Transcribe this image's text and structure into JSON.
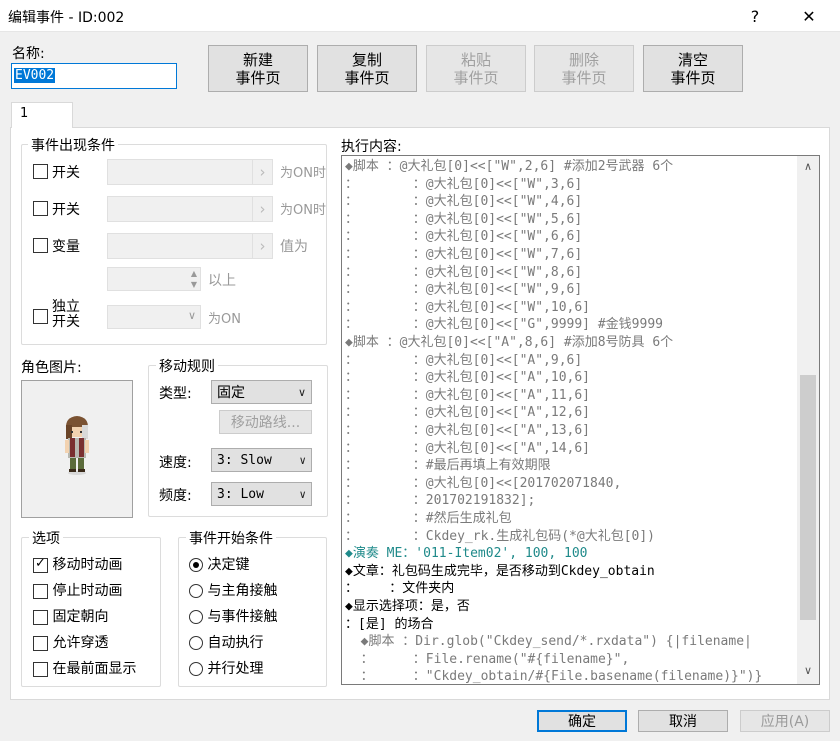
{
  "window": {
    "title": "编辑事件 - ID:002",
    "help": "?",
    "close": "✕"
  },
  "name": {
    "label": "名称:",
    "value": "EV002"
  },
  "top_buttons": [
    {
      "label": "新建\n事件页",
      "enabled": true
    },
    {
      "label": "复制\n事件页",
      "enabled": true
    },
    {
      "label": "粘贴\n事件页",
      "enabled": false
    },
    {
      "label": "删除\n事件页",
      "enabled": false
    },
    {
      "label": "清空\n事件页",
      "enabled": true
    }
  ],
  "tab": {
    "label": "1"
  },
  "conditions": {
    "title": "事件出现条件",
    "switch1": {
      "label": "开关",
      "suffix": "为ON时"
    },
    "switch2": {
      "label": "开关",
      "suffix": "为ON时"
    },
    "variable": {
      "label": "变量",
      "suffix": "值为",
      "suffix2": "以上"
    },
    "self_switch": {
      "label": "独立\n开关",
      "suffix": "为ON"
    }
  },
  "graphic": {
    "title": "角色图片:"
  },
  "movement": {
    "title": "移动规则",
    "type_label": "类型:",
    "type_value": "固定",
    "route_button": "移动路线...",
    "speed_label": "速度:",
    "speed_value": "3: Slow",
    "freq_label": "频度:",
    "freq_value": "3: Low"
  },
  "options": {
    "title": "选项",
    "items": [
      {
        "label": "移动时动画",
        "checked": true
      },
      {
        "label": "停止时动画",
        "checked": false
      },
      {
        "label": "固定朝向",
        "checked": false
      },
      {
        "label": "允许穿透",
        "checked": false
      },
      {
        "label": "在最前面显示",
        "checked": false
      }
    ]
  },
  "trigger": {
    "title": "事件开始条件",
    "items": [
      {
        "label": "决定键",
        "selected": true
      },
      {
        "label": "与主角接触",
        "selected": false
      },
      {
        "label": "与事件接触",
        "selected": false
      },
      {
        "label": "自动执行",
        "selected": false
      },
      {
        "label": "并行处理",
        "selected": false
      }
    ]
  },
  "contents": {
    "title": "执行内容:",
    "lines": [
      {
        "text": "◆脚本 ：@大礼包[0]<<[\"W\",2,6] #添加2号武器 6个",
        "style": "gray"
      },
      {
        "text": "：       ：@大礼包[0]<<[\"W\",3,6]",
        "style": "gray"
      },
      {
        "text": "：       ：@大礼包[0]<<[\"W\",4,6]",
        "style": "gray"
      },
      {
        "text": "：       ：@大礼包[0]<<[\"W\",5,6]",
        "style": "gray"
      },
      {
        "text": "：       ：@大礼包[0]<<[\"W\",6,6]",
        "style": "gray"
      },
      {
        "text": "：       ：@大礼包[0]<<[\"W\",7,6]",
        "style": "gray"
      },
      {
        "text": "：       ：@大礼包[0]<<[\"W\",8,6]",
        "style": "gray"
      },
      {
        "text": "：       ：@大礼包[0]<<[\"W\",9,6]",
        "style": "gray"
      },
      {
        "text": "：       ：@大礼包[0]<<[\"W\",10,6]",
        "style": "gray"
      },
      {
        "text": "：       ：@大礼包[0]<<[\"G\",9999] #金钱9999",
        "style": "gray"
      },
      {
        "text": "◆脚本 ：@大礼包[0]<<[\"A\",8,6] #添加8号防具 6个",
        "style": "gray"
      },
      {
        "text": "：       ：@大礼包[0]<<[\"A\",9,6]",
        "style": "gray"
      },
      {
        "text": "：       ：@大礼包[0]<<[\"A\",10,6]",
        "style": "gray"
      },
      {
        "text": "：       ：@大礼包[0]<<[\"A\",11,6]",
        "style": "gray"
      },
      {
        "text": "：       ：@大礼包[0]<<[\"A\",12,6]",
        "style": "gray"
      },
      {
        "text": "：       ：@大礼包[0]<<[\"A\",13,6]",
        "style": "gray"
      },
      {
        "text": "：       ：@大礼包[0]<<[\"A\",14,6]",
        "style": "gray"
      },
      {
        "text": "：       ：#最后再填上有效期限",
        "style": "gray"
      },
      {
        "text": "：       ：@大礼包[0]<<[201702071840,",
        "style": "gray"
      },
      {
        "text": "：       ：201702191832];",
        "style": "gray"
      },
      {
        "text": "：       ：#然后生成礼包",
        "style": "gray"
      },
      {
        "text": "：       ：Ckdey_rk.生成礼包码(*@大礼包[0])",
        "style": "gray"
      },
      {
        "text": "◆演奏 ME：'011-Item02', 100, 100",
        "style": "teal"
      },
      {
        "text": "◆文章：礼包码生成完毕，是否移动到Ckdey_obtain",
        "style": "black"
      },
      {
        "text": "：    ：文件夹内",
        "style": "black"
      },
      {
        "text": "◆显示选择项：是，否",
        "style": "black"
      },
      {
        "text": "：[是] 的场合",
        "style": "black"
      },
      {
        "text": "  ◆脚本 ：Dir.glob(\"Ckdey_send/*.rxdata\") {|filename|",
        "style": "gray"
      },
      {
        "text": "  ：     ：File.rename(\"#{filename}\",",
        "style": "gray"
      },
      {
        "text": "  ：     ：\"Ckdey_obtain/#{File.basename(filename)}\")}",
        "style": "gray"
      }
    ]
  },
  "bottom_buttons": {
    "ok": "确定",
    "cancel": "取消",
    "apply": "应用(A)"
  }
}
